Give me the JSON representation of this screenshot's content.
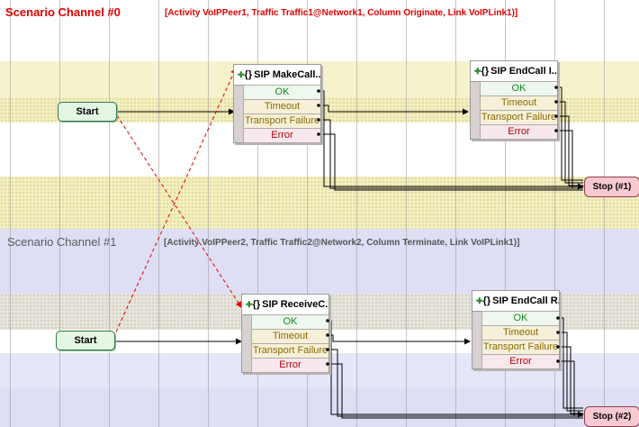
{
  "channel0": {
    "title": "Scenario Channel #0",
    "info": "[Activity VoIPPeer1, Traffic Traffic1@Network1, Column Originate, Link VoIPLink1)]",
    "title_color": "#e00000",
    "start_label": "Start",
    "nodes": [
      {
        "title": "SIP MakeCall...",
        "ports": [
          "OK",
          "Timeout",
          "Transport Failure",
          "Error"
        ]
      },
      {
        "title": "SIP EndCall I...",
        "ports": [
          "OK",
          "Timeout",
          "Transport Failure",
          "Error"
        ]
      }
    ],
    "stop_label": "Stop (#1)"
  },
  "channel1": {
    "title": "Scenario Channel #1",
    "info": "[Activity VoIPPeer2, Traffic Traffic2@Network2, Column Terminate, Link VoIPLink1)]",
    "title_color": "#5a5a5a",
    "start_label": "Start",
    "nodes": [
      {
        "title": "SIP ReceiveC...",
        "ports": [
          "OK",
          "Timeout",
          "Transport Failure",
          "Error"
        ]
      },
      {
        "title": "SIP EndCall R...",
        "ports": [
          "OK",
          "Timeout",
          "Transport Failure",
          "Error"
        ]
      }
    ],
    "stop_label": "Stop (#2)"
  },
  "node_brace": "{}",
  "colors": {
    "ok": "#11881b",
    "timeout": "#8a6a00",
    "error": "#b8000c",
    "sync_line": "#e00000",
    "start_fill": "#e3f5e3",
    "stop_fill": "#f9c9d2"
  }
}
